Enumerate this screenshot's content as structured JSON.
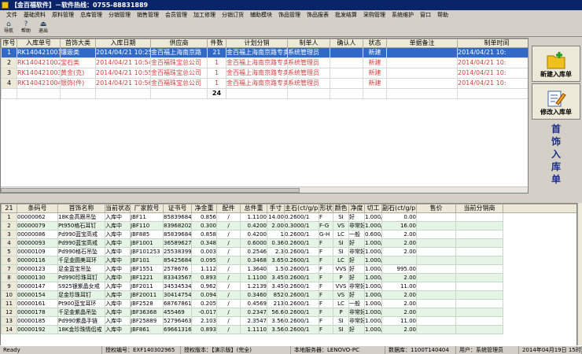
{
  "title": "【金百福软件】－软件热线：0755-88831889",
  "menu": [
    "文件",
    "基础资料",
    "原料管理",
    "总库管理",
    "分销管理",
    "销售管理",
    "会员管理",
    "加工修理",
    "分销订货",
    "辅助模块",
    "饰品管理",
    "饰品报表",
    "批发结算",
    "采购管理",
    "系统维护",
    "窗口",
    "帮助"
  ],
  "toolbar": [
    {
      "label": "导航",
      "icon": "navigate-icon"
    },
    {
      "label": "帮助",
      "icon": "help-icon"
    },
    {
      "label": "退出",
      "icon": "exit-icon"
    }
  ],
  "upper_table": {
    "columns": [
      "序号",
      "入库单号",
      "首饰大类",
      "入库日期",
      "供应商",
      "件数",
      "计划分销",
      "制单人",
      "确认人",
      "状态",
      "单据备注",
      "制单时间"
    ],
    "rows": [
      [
        "1",
        "RK140421001",
        "镶嵌类",
        "2014/04/21 10:25",
        "金百福上海南京路",
        "21",
        "金百福上海南京路专卖",
        "系统管理员",
        "",
        "新建",
        "",
        "2014/04/21 10:"
      ],
      [
        "2",
        "RK140421002",
        "宝石类",
        "2014/04/21 10:54",
        "金百福珠宝总公司",
        "1",
        "金百福上海南京路专卖",
        "系统管理员",
        "",
        "新建",
        "",
        "2014/04/21 10:"
      ],
      [
        "3",
        "RK140421003",
        "黄金(克)",
        "2014/04/21 10:55",
        "金百福珠宝总公司",
        "1",
        "金百福上海南京路专卖",
        "系统管理员",
        "",
        "新建",
        "",
        "2014/04/21 10:"
      ],
      [
        "4",
        "RK140421004",
        "银饰(件)",
        "2014/04/21 10:56",
        "金百福珠宝总公司",
        "1",
        "金百福上海南京路专卖",
        "系统管理员",
        "",
        "新建",
        "",
        "2014/04/21 10:"
      ]
    ],
    "total_count": "24"
  },
  "right_panel": {
    "new_button": "新建入库单",
    "edit_button": "修改入库单",
    "vertical_title": [
      "首",
      "饰",
      "入",
      "库",
      "单"
    ]
  },
  "lower_table": {
    "corner": "21",
    "columns": [
      "条码号",
      "首饰名称",
      "当前状态",
      "厂家款号",
      "证书号",
      "净金重",
      "配件",
      "总件重",
      "手寸",
      "主石(ct/g/p)",
      "形状",
      "颜色",
      "净度",
      "切工",
      "副石(ct/g/p)",
      "售价",
      "当前分销商"
    ],
    "rows": [
      [
        "1",
        "00000062",
        "18K金高跟吊坠",
        "入库中",
        "JBF11",
        "85839684",
        "0.856",
        "/",
        "1.1100",
        "14.00",
        "0.2600/1",
        "F",
        "SI",
        "好",
        "1.000/1",
        "0.00",
        ""
      ],
      [
        "2",
        "00000079",
        "Pt950格石耳钉",
        "入库中",
        "JBF110",
        "83968202",
        "0.300",
        "/",
        "0.4200",
        "2.00",
        "0.3000/1",
        "F-G",
        "VS",
        "非常好",
        "1.000/1",
        "16.00",
        ""
      ],
      [
        "3",
        "00000086",
        "Pd990蓝宝高戒",
        "入库中",
        "JBF885",
        "85839684",
        "0.858",
        "/",
        "0.4200",
        "1",
        "0.2600/1",
        "G-H",
        "LC",
        "一般",
        "0.600/1",
        "2.00",
        ""
      ],
      [
        "4",
        "00000093",
        "Pd990蓝宝高戒",
        "入库中",
        "JBF1001",
        "36589627",
        "0.348",
        "/",
        "0.6000",
        "0.36",
        "0.2600/1",
        "F",
        "SI",
        "好",
        "1.000/1",
        "2.00",
        ""
      ],
      [
        "5",
        "00000109",
        "Pd990格石吊坠",
        "入库中",
        "JBF101253",
        "25538399",
        "0.003",
        "/",
        "0.2546",
        "2.3",
        "0.2600/1",
        "F",
        "SI",
        "非常好",
        "1.000/1",
        "2.00",
        ""
      ],
      [
        "6",
        "00000116",
        "千足金圆美耳环",
        "入库中",
        "JBF101",
        "85425684",
        "0.095",
        "/",
        "0.3468",
        "3.65",
        "0.2600/1",
        "F",
        "LC",
        "好",
        "1.000/1",
        "",
        ""
      ],
      [
        "7",
        "00000123",
        "足金蓝宝吊坠",
        "入库中",
        "JBF1551",
        "2578676",
        "1.112",
        "/",
        "1.3640",
        "1.5",
        "0.2600/1",
        "F",
        "VVS",
        "好",
        "1.000/1",
        "995.00",
        ""
      ],
      [
        "8",
        "00000130",
        "Pd990珍珠耳钉",
        "入库中",
        "JBF1221",
        "83343567",
        "0.893",
        "/",
        "1.1100",
        "3.45",
        "0.2600/1",
        "F",
        "P",
        "好",
        "1.000/1",
        "2.00",
        ""
      ],
      [
        "9",
        "00000147",
        "S925银紫晶女戒",
        "入库中",
        "JBF2011",
        "34534534",
        "0.962",
        "/",
        "1.2139",
        "3.45",
        "0.2600/1",
        "F",
        "VVS",
        "非常好",
        "1.000/1",
        "11.00",
        ""
      ],
      [
        "10",
        "00000154",
        "足金珍珠耳钉",
        "入库中",
        "JBF20011",
        "30414754",
        "0.094",
        "/",
        "0.3460",
        "852",
        "0.2600/1",
        "F",
        "VS",
        "好",
        "1.000/1",
        "2.00",
        ""
      ],
      [
        "11",
        "00000161",
        "Pt900蓝宝耳环",
        "入库中",
        "JBF2528",
        "68767861",
        "0.205",
        "/",
        "0.4569",
        "213",
        "0.2600/1",
        "F",
        "LC",
        "一般",
        "1.000/1",
        "2.00",
        ""
      ],
      [
        "12",
        "00000178",
        "千足金紫晶吊坠",
        "入库中",
        "JBF36368",
        "455469",
        "-0.017",
        "/",
        "0.2347",
        "56.6",
        "0.2600/1",
        "F",
        "P",
        "非常好",
        "1.000/1",
        "2.00",
        ""
      ],
      [
        "13",
        "00000185",
        "Pd990紫晶手链",
        "入库中",
        "JBF25889",
        "52796463",
        "2.103",
        "/",
        "2.3547",
        "3.56",
        "0.2600/1",
        "F",
        "SI",
        "非常好",
        "1.000/1",
        "11.00",
        ""
      ],
      [
        "14",
        "00000192",
        "18K金珍珠情侣戒",
        "入库中",
        "JBF861",
        "69661316",
        "0.893",
        "/",
        "1.1110",
        "3.56",
        "0.2600/1",
        "F",
        "SI",
        "好",
        "1.000/1",
        "2.00",
        ""
      ]
    ]
  },
  "statusbar": [
    "Ready",
    "授权编号：EXF140302965",
    "授权版本：【演示版】(完全)",
    "本地服务器：LENOVO-PC",
    "数据库：1100T140404",
    "用户：系统管理员",
    "2014年04月19日 15时44分30秒"
  ]
}
